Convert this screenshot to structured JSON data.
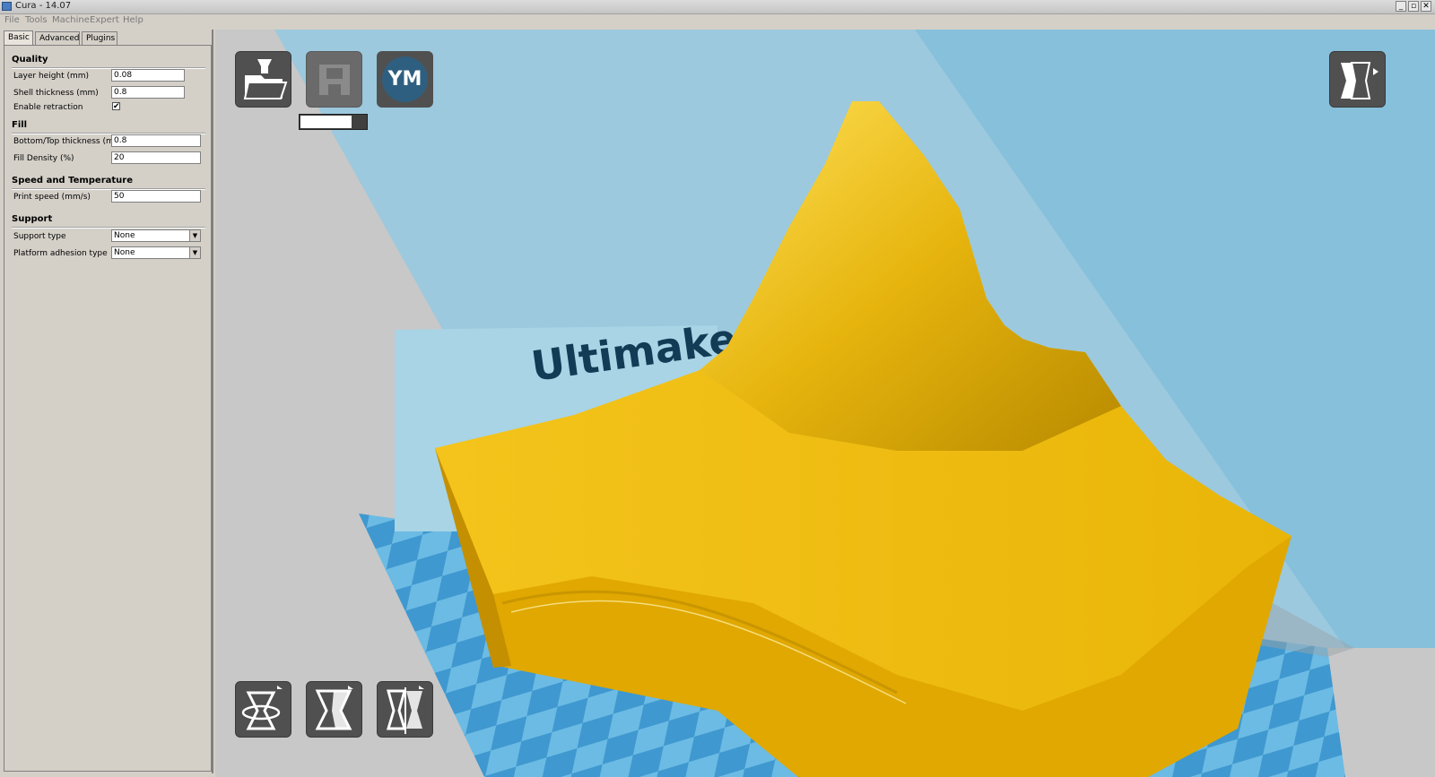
{
  "window": {
    "title": "Cura - 14.07",
    "minimize": "_",
    "restore": "▫",
    "close": "✕"
  },
  "menu": [
    "File",
    "Tools",
    "Machine",
    "Expert",
    "Help"
  ],
  "tabs": [
    "Basic",
    "Advanced",
    "Plugins"
  ],
  "settings": {
    "quality": {
      "heading": "Quality",
      "layer_height_label": "Layer height (mm)",
      "layer_height_value": "0.08",
      "shell_thickness_label": "Shell thickness (mm)",
      "shell_thickness_value": "0.8",
      "retraction_label": "Enable retraction",
      "retraction_checked": "✔"
    },
    "fill": {
      "heading": "Fill",
      "bottom_top_label": "Bottom/Top thickness (mm)",
      "bottom_top_value": "0.8",
      "density_label": "Fill Density (%)",
      "density_value": "20"
    },
    "speed": {
      "heading": "Speed and Temperature",
      "print_speed_label": "Print speed (mm/s)",
      "print_speed_value": "50"
    },
    "support": {
      "heading": "Support",
      "support_type_label": "Support type",
      "support_type_value": "None",
      "adhesion_label": "Platform adhesion type",
      "adhesion_value": "None"
    }
  },
  "viewport": {
    "watermark": "Ultimake",
    "ym_badge": "YM",
    "slice_progress": 0.78,
    "colors": {
      "model": "#f2c31a",
      "sky": "#8fc3da",
      "checker_light": "#6bbbe4",
      "checker_dark": "#3f98cf"
    },
    "icons": [
      "load-model-icon",
      "save-toolpath-icon",
      "youmagine-icon",
      "view-mode-icon",
      "rotate-icon",
      "scale-icon",
      "mirror-icon"
    ]
  }
}
